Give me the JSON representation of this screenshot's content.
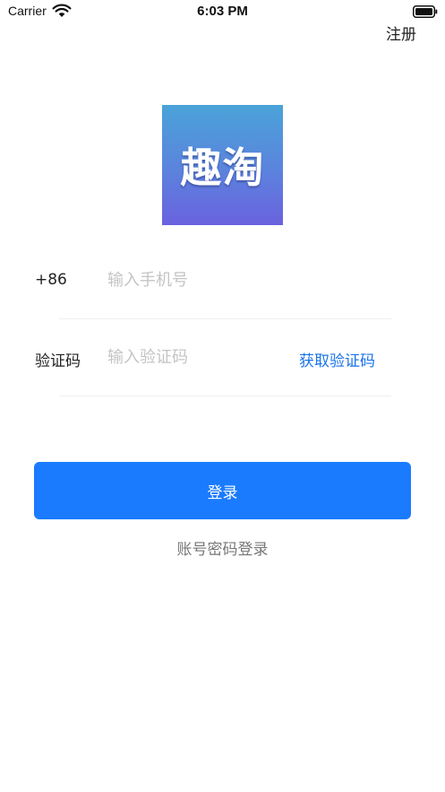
{
  "status_bar": {
    "carrier": "Carrier",
    "time": "6:03 PM",
    "wifi_icon": "wifi-icon",
    "battery_icon": "battery-icon"
  },
  "header": {
    "register_label": "注册"
  },
  "logo": {
    "text": "趣淘",
    "gradient_top": "#4aa3d8",
    "gradient_bottom": "#6a62df"
  },
  "form": {
    "phone": {
      "country_code": "+86",
      "placeholder": "输入手机号",
      "value": ""
    },
    "code": {
      "label": "验证码",
      "placeholder": "输入验证码",
      "value": "",
      "get_code_label": "获取验证码"
    }
  },
  "actions": {
    "login_label": "登录",
    "password_login_label": "账号密码登录"
  },
  "colors": {
    "primary": "#1a7bff",
    "link": "#1a73e8",
    "secondary_text": "#777777",
    "placeholder": "#c4c4c4"
  }
}
